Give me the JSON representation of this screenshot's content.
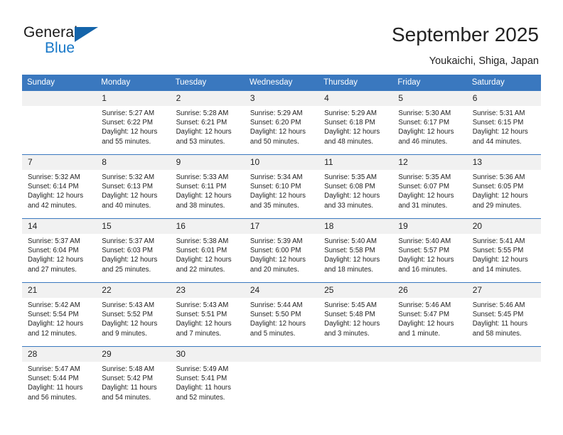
{
  "brand": {
    "name_top": "General",
    "name_bottom": "Blue",
    "accent_color": "#1878c8",
    "triangle_color": "#1464aa"
  },
  "header": {
    "title": "September 2025",
    "subtitle": "Youkaichi, Shiga, Japan"
  },
  "calendar": {
    "header_bg": "#3a78bf",
    "daynum_bg": "#f1f1f1",
    "weekday_headers": [
      "Sunday",
      "Monday",
      "Tuesday",
      "Wednesday",
      "Thursday",
      "Friday",
      "Saturday"
    ],
    "weeks": [
      [
        {
          "day": "",
          "lines": []
        },
        {
          "day": "1",
          "lines": [
            "Sunrise: 5:27 AM",
            "Sunset: 6:22 PM",
            "Daylight: 12 hours",
            "and 55 minutes."
          ]
        },
        {
          "day": "2",
          "lines": [
            "Sunrise: 5:28 AM",
            "Sunset: 6:21 PM",
            "Daylight: 12 hours",
            "and 53 minutes."
          ]
        },
        {
          "day": "3",
          "lines": [
            "Sunrise: 5:29 AM",
            "Sunset: 6:20 PM",
            "Daylight: 12 hours",
            "and 50 minutes."
          ]
        },
        {
          "day": "4",
          "lines": [
            "Sunrise: 5:29 AM",
            "Sunset: 6:18 PM",
            "Daylight: 12 hours",
            "and 48 minutes."
          ]
        },
        {
          "day": "5",
          "lines": [
            "Sunrise: 5:30 AM",
            "Sunset: 6:17 PM",
            "Daylight: 12 hours",
            "and 46 minutes."
          ]
        },
        {
          "day": "6",
          "lines": [
            "Sunrise: 5:31 AM",
            "Sunset: 6:15 PM",
            "Daylight: 12 hours",
            "and 44 minutes."
          ]
        }
      ],
      [
        {
          "day": "7",
          "lines": [
            "Sunrise: 5:32 AM",
            "Sunset: 6:14 PM",
            "Daylight: 12 hours",
            "and 42 minutes."
          ]
        },
        {
          "day": "8",
          "lines": [
            "Sunrise: 5:32 AM",
            "Sunset: 6:13 PM",
            "Daylight: 12 hours",
            "and 40 minutes."
          ]
        },
        {
          "day": "9",
          "lines": [
            "Sunrise: 5:33 AM",
            "Sunset: 6:11 PM",
            "Daylight: 12 hours",
            "and 38 minutes."
          ]
        },
        {
          "day": "10",
          "lines": [
            "Sunrise: 5:34 AM",
            "Sunset: 6:10 PM",
            "Daylight: 12 hours",
            "and 35 minutes."
          ]
        },
        {
          "day": "11",
          "lines": [
            "Sunrise: 5:35 AM",
            "Sunset: 6:08 PM",
            "Daylight: 12 hours",
            "and 33 minutes."
          ]
        },
        {
          "day": "12",
          "lines": [
            "Sunrise: 5:35 AM",
            "Sunset: 6:07 PM",
            "Daylight: 12 hours",
            "and 31 minutes."
          ]
        },
        {
          "day": "13",
          "lines": [
            "Sunrise: 5:36 AM",
            "Sunset: 6:05 PM",
            "Daylight: 12 hours",
            "and 29 minutes."
          ]
        }
      ],
      [
        {
          "day": "14",
          "lines": [
            "Sunrise: 5:37 AM",
            "Sunset: 6:04 PM",
            "Daylight: 12 hours",
            "and 27 minutes."
          ]
        },
        {
          "day": "15",
          "lines": [
            "Sunrise: 5:37 AM",
            "Sunset: 6:03 PM",
            "Daylight: 12 hours",
            "and 25 minutes."
          ]
        },
        {
          "day": "16",
          "lines": [
            "Sunrise: 5:38 AM",
            "Sunset: 6:01 PM",
            "Daylight: 12 hours",
            "and 22 minutes."
          ]
        },
        {
          "day": "17",
          "lines": [
            "Sunrise: 5:39 AM",
            "Sunset: 6:00 PM",
            "Daylight: 12 hours",
            "and 20 minutes."
          ]
        },
        {
          "day": "18",
          "lines": [
            "Sunrise: 5:40 AM",
            "Sunset: 5:58 PM",
            "Daylight: 12 hours",
            "and 18 minutes."
          ]
        },
        {
          "day": "19",
          "lines": [
            "Sunrise: 5:40 AM",
            "Sunset: 5:57 PM",
            "Daylight: 12 hours",
            "and 16 minutes."
          ]
        },
        {
          "day": "20",
          "lines": [
            "Sunrise: 5:41 AM",
            "Sunset: 5:55 PM",
            "Daylight: 12 hours",
            "and 14 minutes."
          ]
        }
      ],
      [
        {
          "day": "21",
          "lines": [
            "Sunrise: 5:42 AM",
            "Sunset: 5:54 PM",
            "Daylight: 12 hours",
            "and 12 minutes."
          ]
        },
        {
          "day": "22",
          "lines": [
            "Sunrise: 5:43 AM",
            "Sunset: 5:52 PM",
            "Daylight: 12 hours",
            "and 9 minutes."
          ]
        },
        {
          "day": "23",
          "lines": [
            "Sunrise: 5:43 AM",
            "Sunset: 5:51 PM",
            "Daylight: 12 hours",
            "and 7 minutes."
          ]
        },
        {
          "day": "24",
          "lines": [
            "Sunrise: 5:44 AM",
            "Sunset: 5:50 PM",
            "Daylight: 12 hours",
            "and 5 minutes."
          ]
        },
        {
          "day": "25",
          "lines": [
            "Sunrise: 5:45 AM",
            "Sunset: 5:48 PM",
            "Daylight: 12 hours",
            "and 3 minutes."
          ]
        },
        {
          "day": "26",
          "lines": [
            "Sunrise: 5:46 AM",
            "Sunset: 5:47 PM",
            "Daylight: 12 hours",
            "and 1 minute."
          ]
        },
        {
          "day": "27",
          "lines": [
            "Sunrise: 5:46 AM",
            "Sunset: 5:45 PM",
            "Daylight: 11 hours",
            "and 58 minutes."
          ]
        }
      ],
      [
        {
          "day": "28",
          "lines": [
            "Sunrise: 5:47 AM",
            "Sunset: 5:44 PM",
            "Daylight: 11 hours",
            "and 56 minutes."
          ]
        },
        {
          "day": "29",
          "lines": [
            "Sunrise: 5:48 AM",
            "Sunset: 5:42 PM",
            "Daylight: 11 hours",
            "and 54 minutes."
          ]
        },
        {
          "day": "30",
          "lines": [
            "Sunrise: 5:49 AM",
            "Sunset: 5:41 PM",
            "Daylight: 11 hours",
            "and 52 minutes."
          ]
        },
        {
          "day": "",
          "lines": []
        },
        {
          "day": "",
          "lines": []
        },
        {
          "day": "",
          "lines": []
        },
        {
          "day": "",
          "lines": []
        }
      ]
    ]
  }
}
